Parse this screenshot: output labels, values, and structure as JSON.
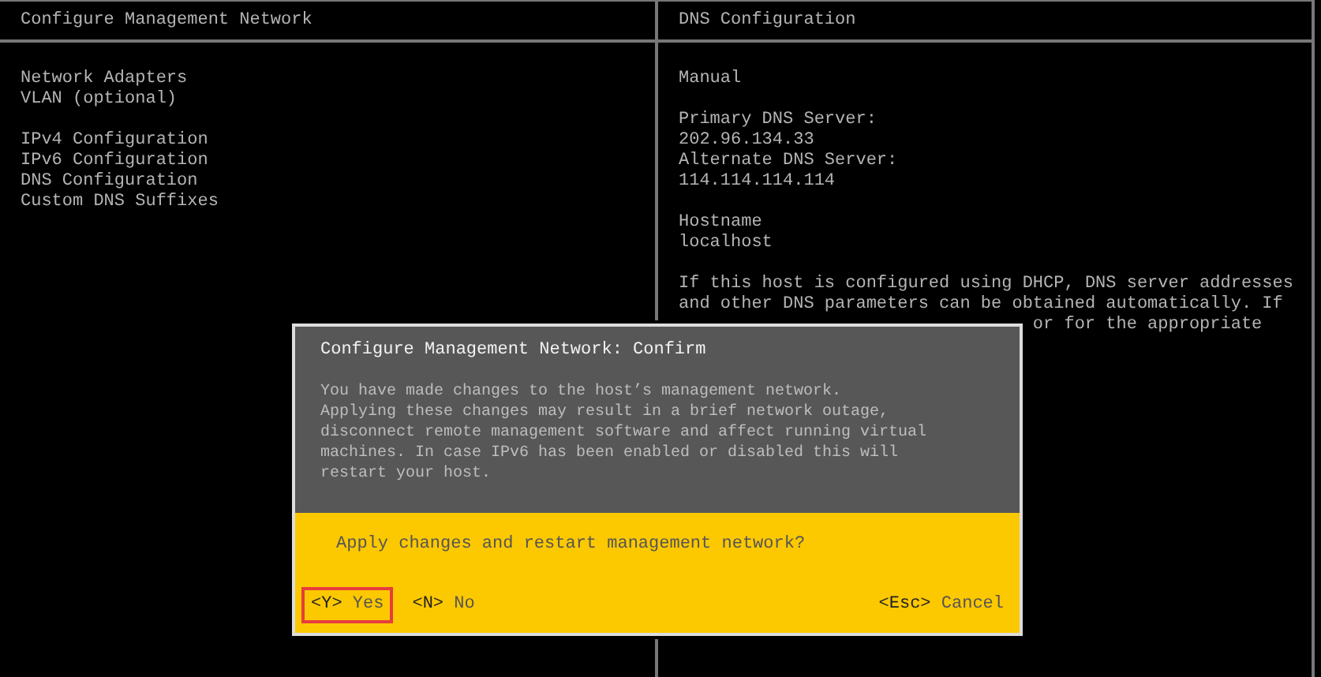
{
  "left_panel": {
    "title": "Configure Management Network",
    "menu_groups": [
      {
        "items": [
          {
            "label": "Network Adapters"
          },
          {
            "label": "VLAN (optional)"
          }
        ]
      },
      {
        "items": [
          {
            "label": "IPv4 Configuration"
          },
          {
            "label": "IPv6 Configuration"
          },
          {
            "label": "DNS Configuration"
          },
          {
            "label": "Custom DNS Suffixes"
          }
        ]
      }
    ]
  },
  "right_panel": {
    "title": "DNS Configuration",
    "mode": "Manual",
    "fields": [
      {
        "label": "Primary DNS Server:",
        "value": "202.96.134.33"
      },
      {
        "label": "Alternate DNS Server:",
        "value": "114.114.114.114"
      }
    ],
    "hostname": {
      "label": "Hostname",
      "value": "localhost"
    },
    "description_lines": [
      "If this host is configured using DHCP, DNS server addresses",
      "and other DNS parameters can be obtained automatically. If"
    ],
    "description_cut_line": "or for the appropriate"
  },
  "dialog": {
    "title": "Configure Management Network: Confirm",
    "message": "You have made changes to the host’s management network.\nApplying these changes may result in a brief network outage,\ndisconnect remote management software and affect running virtual\nmachines. In case IPv6 has been enabled or disabled this will\nrestart your host.",
    "question": "Apply changes and restart management network?",
    "left_buttons": [
      {
        "key": "<Y>",
        "label": "Yes",
        "selected": true
      },
      {
        "key": "<N>",
        "label": "No",
        "selected": false
      }
    ],
    "right_buttons": [
      {
        "key": "<Esc>",
        "label": "Cancel",
        "selected": false
      }
    ]
  }
}
